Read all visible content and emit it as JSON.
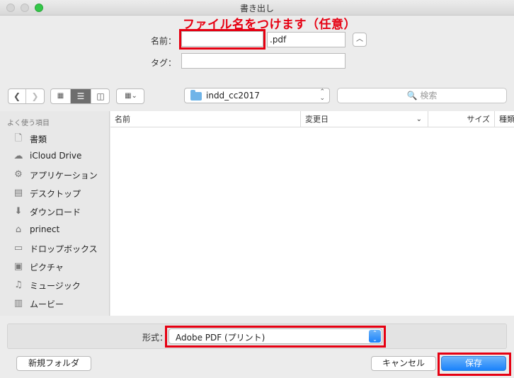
{
  "window": {
    "title": "書き出し"
  },
  "annotation": {
    "text": "ファイル名をつけます（任意）"
  },
  "form": {
    "name_label": "名前：",
    "name_value": "",
    "extension": ".pdf",
    "tags_label": "タグ：",
    "tags_value": ""
  },
  "toolbar": {
    "location": "indd_cc2017",
    "search_placeholder": "🔍 検索"
  },
  "sidebar": {
    "section": "よく使う項目",
    "items": [
      {
        "label": "書類",
        "icon": "document-icon"
      },
      {
        "label": "iCloud Drive",
        "icon": "cloud-icon"
      },
      {
        "label": "アプリケーション",
        "icon": "applications-icon"
      },
      {
        "label": "デスクトップ",
        "icon": "desktop-icon"
      },
      {
        "label": "ダウンロード",
        "icon": "download-icon"
      },
      {
        "label": "prinect",
        "icon": "home-icon"
      },
      {
        "label": "ドロップボックス",
        "icon": "folder-icon"
      },
      {
        "label": "ピクチャ",
        "icon": "camera-icon"
      },
      {
        "label": "ミュージック",
        "icon": "music-icon"
      },
      {
        "label": "ムービー",
        "icon": "film-icon"
      }
    ]
  },
  "columns": {
    "name": "名前",
    "modified": "変更日",
    "size": "サイズ",
    "kind": "種類"
  },
  "format": {
    "label": "形式：",
    "value": "Adobe PDF (プリント)"
  },
  "buttons": {
    "new_folder": "新規フォルダ",
    "cancel": "キャンセル",
    "save": "保存"
  },
  "colors": {
    "annotation": "#e60012",
    "accent": "#1a82fb"
  }
}
